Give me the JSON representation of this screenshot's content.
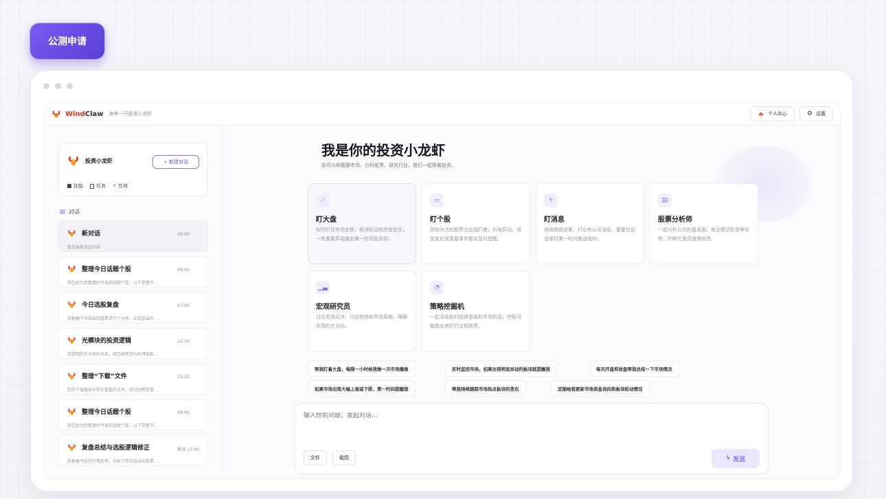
{
  "apply_label": "公测申请",
  "topbar": {
    "brand_wind": "Wind",
    "brand_claw": "Claw",
    "tagline": "来养一只投资小龙虾",
    "profile_label": "个人中心",
    "settings_label": "设置"
  },
  "sidebar": {
    "profile_name": "投资小龙虾",
    "new_chat_label": "+ 新建对话",
    "tabs": [
      "技能",
      "任务",
      "性格"
    ],
    "conversations_header": "对话",
    "conversations": [
      {
        "title": "新对话",
        "time": "20:00",
        "preview": "暂无最新对话内容"
      },
      {
        "title": "整理今日话题个股",
        "time": "09:00",
        "preview": "我已经为您整理好今天的话题个股，以下是基于..."
      },
      {
        "title": "今日选股复盘",
        "time": "17:00",
        "preview": "我根据今天选出的股票进行了分析，从我选出的..."
      },
      {
        "title": "光模块的投资逻辑",
        "time": "12:30",
        "preview": "您提到的光与铜的关系，我已经帮您分析可能影..."
      },
      {
        "title": "整理“下载”文件",
        "time": "10:10",
        "preview": "您的下载路径中存在重要的文件，我已经帮您整..."
      },
      {
        "title": "整理今日话题个股",
        "time": "09:03",
        "preview": "我已经为您整理好今天的话题个股，以下是基于..."
      },
      {
        "title": "复盘总结与选股逻辑修正",
        "time": "昨天 17:00",
        "preview": "我根据今日的行情走势，分析了昨日选出的股票..."
      }
    ]
  },
  "hero": {
    "title": "我是你的投资小龙虾",
    "subtitle": "你可以和我聊市场、分析股票、研究行业，我们一起帮做投资。"
  },
  "cards": [
    {
      "title": "盯大盘",
      "desc": "实时盯住市场走势、板块轮动和资金变化，一有重要异动我会第一时间告诉你。"
    },
    {
      "title": "盯个股",
      "desc": "把你关注的股票交给我盯着，价格异动、资金变化或重要事件都会及时提醒。"
    },
    {
      "title": "盯消息",
      "desc": "持续跟踪政策、行业和公司消息，重要信息出现时第一时间推送给你。"
    },
    {
      "title": "股票分析师",
      "desc": "一起分析公司的基本面、商业模式和竞争优势，判断它是否值得投资。"
    },
    {
      "title": "宏观研究员",
      "desc": "讨论宏观经济、行业趋势和市场周期，理解市场的大方向。"
    },
    {
      "title": "策略挖掘机",
      "desc": "一起寻找新的投资思路和市场机会，挖掘可能跑出来的行业和股票。"
    }
  ],
  "suggestions": [
    "帮我盯着大盘，每隔一小时给我做一次市场播报",
    "实时监控市场，如果出现明显异动的板块就提醒我",
    "每天开盘和收盘帮我总结一下市场情况",
    "如果市场出现大幅上涨或下跌，第一时间提醒我",
    "帮我持续跟踪市场热点板块的变化",
    "定期给我更新市场资金流向和板块轮动情况"
  ],
  "composer": {
    "placeholder": "输入你的问题，发起对话...",
    "file_label": "文件",
    "screenshot_label": "截图",
    "send_label": "发送"
  }
}
